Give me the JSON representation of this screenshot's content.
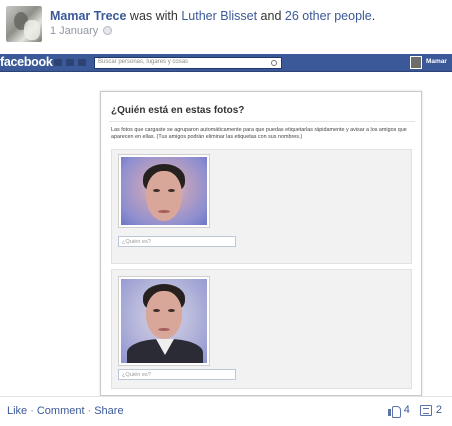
{
  "post": {
    "author": "Mamar Trece",
    "with_text": " was with ",
    "tagged_person": "Luther Blisset",
    "and_text": " and ",
    "others_link": "26 other people",
    "end_text": ".",
    "date": "1 January",
    "privacy_icon": "globe-icon"
  },
  "screenshot": {
    "logo": "facebook",
    "search_placeholder": "Buscar personas, lugares y cosas",
    "user_name": "Mamar",
    "dialog_title": "¿Quién está en estas fotos?",
    "dialog_description": "Las fotos que cargaste se agruparon automáticamente para que puedas etiquetarlas rápidamente y avisar a los amigos que aparecen en ellas. (Tus amigos podrán eliminar las etiquetas con sus nombres.)",
    "tag_input_1": "¿Quién es?",
    "tag_input_2": "¿Quién es?"
  },
  "actions": {
    "like": "Like",
    "comment": "Comment",
    "share": "Share",
    "separator": "·",
    "like_count": "4",
    "comment_count": "2"
  },
  "colors": {
    "brand_blue": "#3b5998",
    "link_blue": "#3b5998",
    "meta_gray": "#9197a3"
  }
}
